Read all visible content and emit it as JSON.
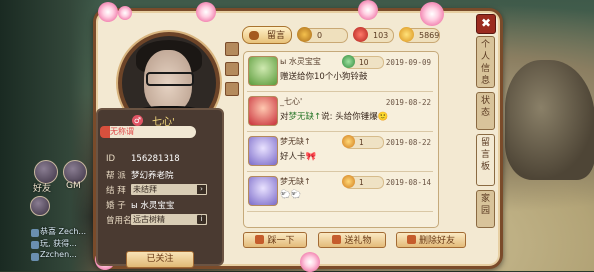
{
  "close_label": "✖",
  "profile": {
    "nickname": "_七心'",
    "gender_symbol": "♂",
    "title": "无称谓",
    "fields": [
      {
        "label": "ID",
        "value": "156281318"
      },
      {
        "label": "帮 派",
        "value": "梦幻养老院"
      },
      {
        "label": "结 拜",
        "value": "未结拜"
      },
      {
        "label": "婚 子",
        "value": "ы 水灵宝宝"
      },
      {
        "label": "曾用名",
        "value": "远古树精"
      }
    ],
    "follow_label": "已关注"
  },
  "board": {
    "message_button": "留言",
    "stats": [
      {
        "icon": "treasure-chest-icon",
        "value": "0"
      },
      {
        "icon": "red-coin-icon",
        "value": "103"
      },
      {
        "icon": "star-icon",
        "value": "5869"
      }
    ],
    "messages": [
      {
        "name": "ы 水灵宝宝",
        "gift_icon": "green-gift-icon",
        "gift_count": "10",
        "date": "2019-09-09",
        "text_prefix": "",
        "text_highlight": "",
        "text": "赠送给你10个小狗铃鼓",
        "avatar_color": "#7cbf5a"
      },
      {
        "name": "_七心'",
        "gift_icon": "",
        "gift_count": "",
        "date": "2019-08-22",
        "text_prefix": "对",
        "text_highlight": "梦无缺↑",
        "text": "说: 头给你锤爆🙂",
        "avatar_color": "#d6404a"
      },
      {
        "name": "梦无缺↑",
        "gift_icon": "flower-gift-icon",
        "gift_count": "1",
        "date": "2019-08-22",
        "text_prefix": "",
        "text_highlight": "",
        "text": "好人卡🎀",
        "avatar_color": "#9c8ed6"
      },
      {
        "name": "梦无缺↑",
        "gift_icon": "flower-gift-icon",
        "gift_count": "1",
        "date": "2019-08-14",
        "text_prefix": "",
        "text_highlight": "",
        "text": "🐑🐑",
        "avatar_color": "#9c8ed6"
      }
    ],
    "actions": [
      "踩一下",
      "送礼物",
      "删除好友"
    ]
  },
  "side_tabs": [
    "个人信息",
    "状态",
    "留言板",
    "家园"
  ],
  "hud": {
    "friends_label": "好友",
    "gm_label": "GM",
    "chat": [
      "恭喜 Zech...",
      "玩, 获得...",
      "Zzchen..."
    ]
  }
}
